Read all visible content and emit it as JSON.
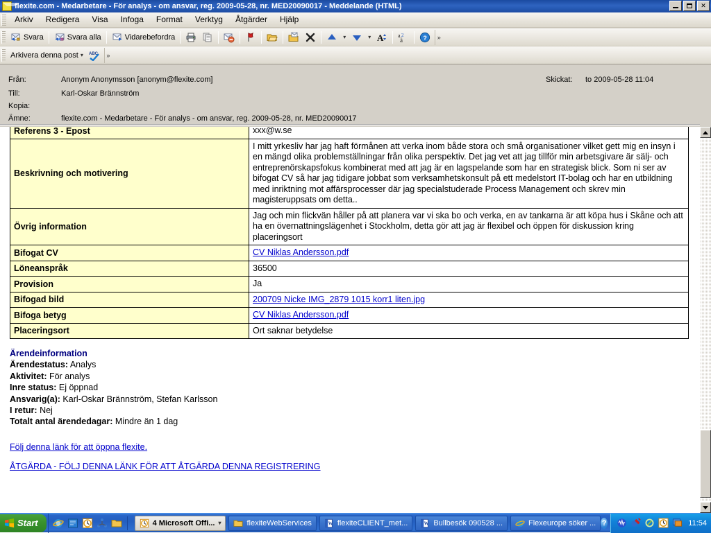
{
  "window": {
    "title": "flexite.com - Medarbetare - För analys - om ansvar, reg. 2009-05-28, nr. MED20090017 - Meddelande (HTML)",
    "app_icon": "envelope-icon",
    "minimize_label": "_",
    "restore_label": "❐",
    "close_label": "✕"
  },
  "menu": {
    "items": [
      {
        "label": "Arkiv",
        "accel": "A"
      },
      {
        "label": "Redigera",
        "accel": "R"
      },
      {
        "label": "Visa",
        "accel": "V"
      },
      {
        "label": "Infoga",
        "accel": "n"
      },
      {
        "label": "Format",
        "accel": "t"
      },
      {
        "label": "Verktyg",
        "accel": "y"
      },
      {
        "label": "Åtgärder",
        "accel": "Å"
      },
      {
        "label": "Hjälp",
        "accel": "H"
      }
    ]
  },
  "toolbar": {
    "reply_label": "Svara",
    "reply_all_label": "Svara alla",
    "forward_label": "Vidarebefordra",
    "icons": [
      "print-icon",
      "copy-icon",
      "block-sender-icon",
      "flag-icon",
      "open-folder-icon",
      "move-to-folder-icon",
      "delete-icon",
      "previous-item-icon",
      "previous-dropdown-icon",
      "next-item-icon",
      "next-dropdown-icon",
      "font-size-icon",
      "translate-icon",
      "help-icon"
    ],
    "overflow_label": "»"
  },
  "toolbar2": {
    "archive_label": "Arkivera denna post",
    "archive_dropdown": "▾",
    "spelling_icon": "spelling-check-icon",
    "overflow_label": "»"
  },
  "header": {
    "from_label": "Från:",
    "from_value": "Anonym Anonymsson [anonym@flexite.com]",
    "to_label": "Till:",
    "to_value": "Karl-Oskar Brännström",
    "cc_label": "Kopia:",
    "cc_value": "",
    "subject_label": "Ämne:",
    "subject_value": "flexite.com - Medarbetare - För analys - om ansvar, reg. 2009-05-28, nr. MED20090017",
    "sent_label": "Skickat:",
    "sent_value": "to 2009-05-28 11:04"
  },
  "body": {
    "table_rows": [
      {
        "key": "Referens 3 - Epost",
        "value": "xxx@w.se",
        "type": "text",
        "clipped": true
      },
      {
        "key": "Beskrivning och motivering",
        "value": "I mitt yrkesliv har jag haft förmånen att verka inom både stora och små organisationer vilket gett mig en insyn i en mängd olika problemställningar från olika perspektiv. Det jag vet att jag tillför min arbetsgivare är sälj- och entreprenörskapsfokus kombinerat med att jag är en lagspelande som har en strategisk blick. Som ni ser av bifogat CV så har jag tidigare jobbat som verksamhetskonsult på ett medelstort IT-bolag och har en utbildning med inriktning mot affärsprocesser där jag specialstuderade Process Management och skrev min magisteruppsats om detta..",
        "type": "text"
      },
      {
        "key": "Övrig information",
        "value": "Jag och min flickvän håller på att planera var vi ska bo och verka, en av tankarna är att köpa hus i Skåne och att ha en övernattningslägenhet i Stockholm, detta gör att jag är flexibel och öppen för diskussion kring placeringsort",
        "type": "text"
      },
      {
        "key": "Bifogat CV",
        "value": "CV Niklas Andersson.pdf",
        "type": "link"
      },
      {
        "key": "Löneanspråk",
        "value": "36500",
        "type": "text"
      },
      {
        "key": "Provision",
        "value": "Ja",
        "type": "text"
      },
      {
        "key": "Bifogad bild",
        "value": "200709 Nicke IMG_2879 1015 korr1 liten.jpg",
        "type": "link"
      },
      {
        "key": "Bifoga betyg",
        "value": "CV Niklas Andersson.pdf",
        "type": "link"
      },
      {
        "key": "Placeringsort",
        "value": "Ort saknar betydelse",
        "type": "text"
      }
    ],
    "case_info": {
      "heading": "Ärendeinformation",
      "fields": [
        {
          "label": "Ärendestatus:",
          "value": "Analys"
        },
        {
          "label": "Aktivitet:",
          "value": "För analys"
        },
        {
          "label": "Inre status:",
          "value": "Ej öppnad"
        },
        {
          "label": "Ansvarig(a):",
          "value": "Karl-Oskar Brännström, Stefan Karlsson"
        },
        {
          "label": "I retur:",
          "value": "Nej"
        },
        {
          "label": "Totalt antal ärendedagar:",
          "value": "Mindre än 1 dag"
        }
      ]
    },
    "links": [
      "Följ denna länk för att öppna flexite.",
      "ÅTGÄRDA - FÖLJ DENNA LÄNK FÖR ATT ÅTGÄRDA DENNA REGISTRERING"
    ]
  },
  "scrollbar": {
    "up_arrow": "▲",
    "down_arrow": "▼"
  },
  "taskbar": {
    "start_label": "Start",
    "quick_launch": [
      "internet-explorer-icon",
      "show-desktop-icon",
      "outlook-icon",
      "network-icon",
      "folder-icon"
    ],
    "buttons": [
      {
        "label": "4 Microsoft Offi...",
        "icon": "outlook-icon",
        "active": true,
        "dropdown": "▾"
      },
      {
        "label": "flexiteWebServices",
        "icon": "folder-icon",
        "active": false
      },
      {
        "label": "flexiteCLIENT_met...",
        "icon": "word-icon",
        "active": false
      },
      {
        "label": "Bullbesök 090528 ...",
        "icon": "word-icon",
        "active": false
      },
      {
        "label": "Flexeurope söker ...",
        "icon": "internet-explorer-icon",
        "active": false
      }
    ],
    "tray_help": "?",
    "tray_icons": [
      "sound-icon",
      "antivirus-icon",
      "shield-icon",
      "clock-icon",
      "display-icon"
    ],
    "clock": "11:54"
  },
  "colors": {
    "titlebar": "#1c4ba3",
    "table_key_bg": "#ffffcc",
    "link": "#0000cc",
    "heading": "#000080",
    "window_face": "#d4d0c8"
  }
}
